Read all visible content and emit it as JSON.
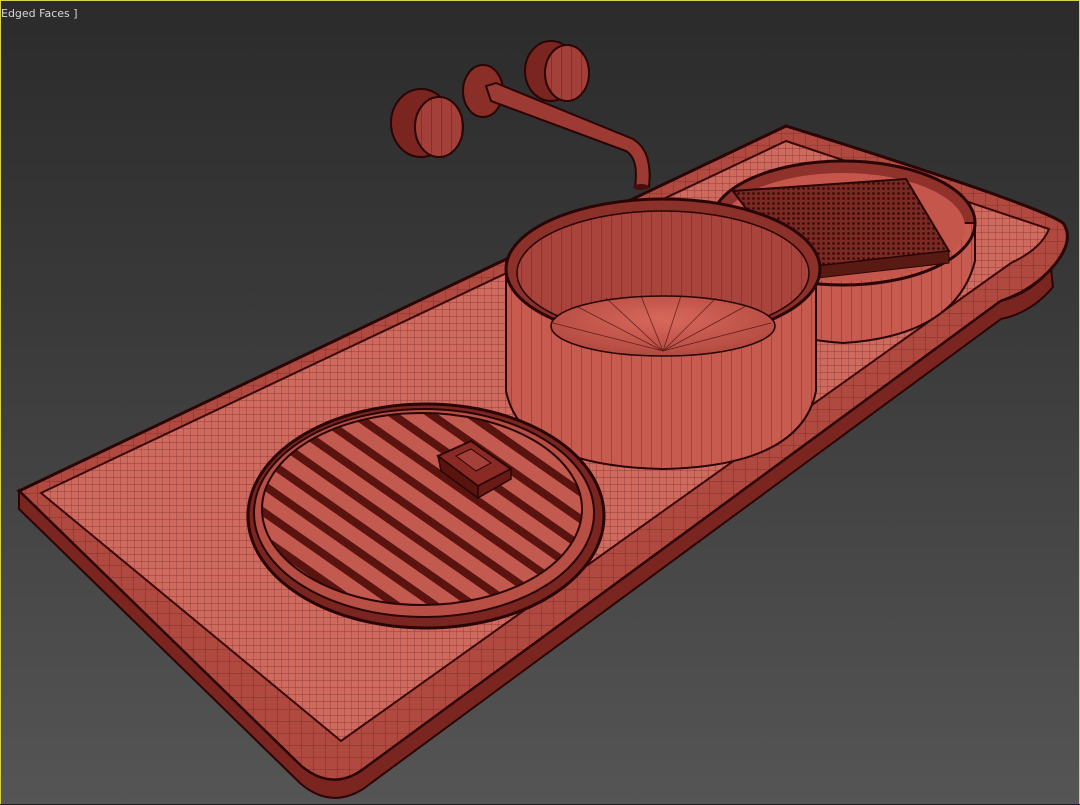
{
  "viewport": {
    "label": "Edged Faces ]",
    "border_color": "#d8d24a",
    "background_top": "#2b2b2b",
    "background_bottom": "#555555"
  },
  "scene": {
    "description_icon": "wireframe-mesh",
    "mesh_fill_color": "#c8594e",
    "mesh_wire_color": "#3a0a0a",
    "objects": [
      "countertop-tray",
      "faucet-spout",
      "faucet-handle-left",
      "faucet-handle-right",
      "wall-flange",
      "vessel-sink",
      "round-soap-bowl",
      "ribbed-lid",
      "soap-bar",
      "folded-towel",
      "towel-bowl"
    ]
  }
}
